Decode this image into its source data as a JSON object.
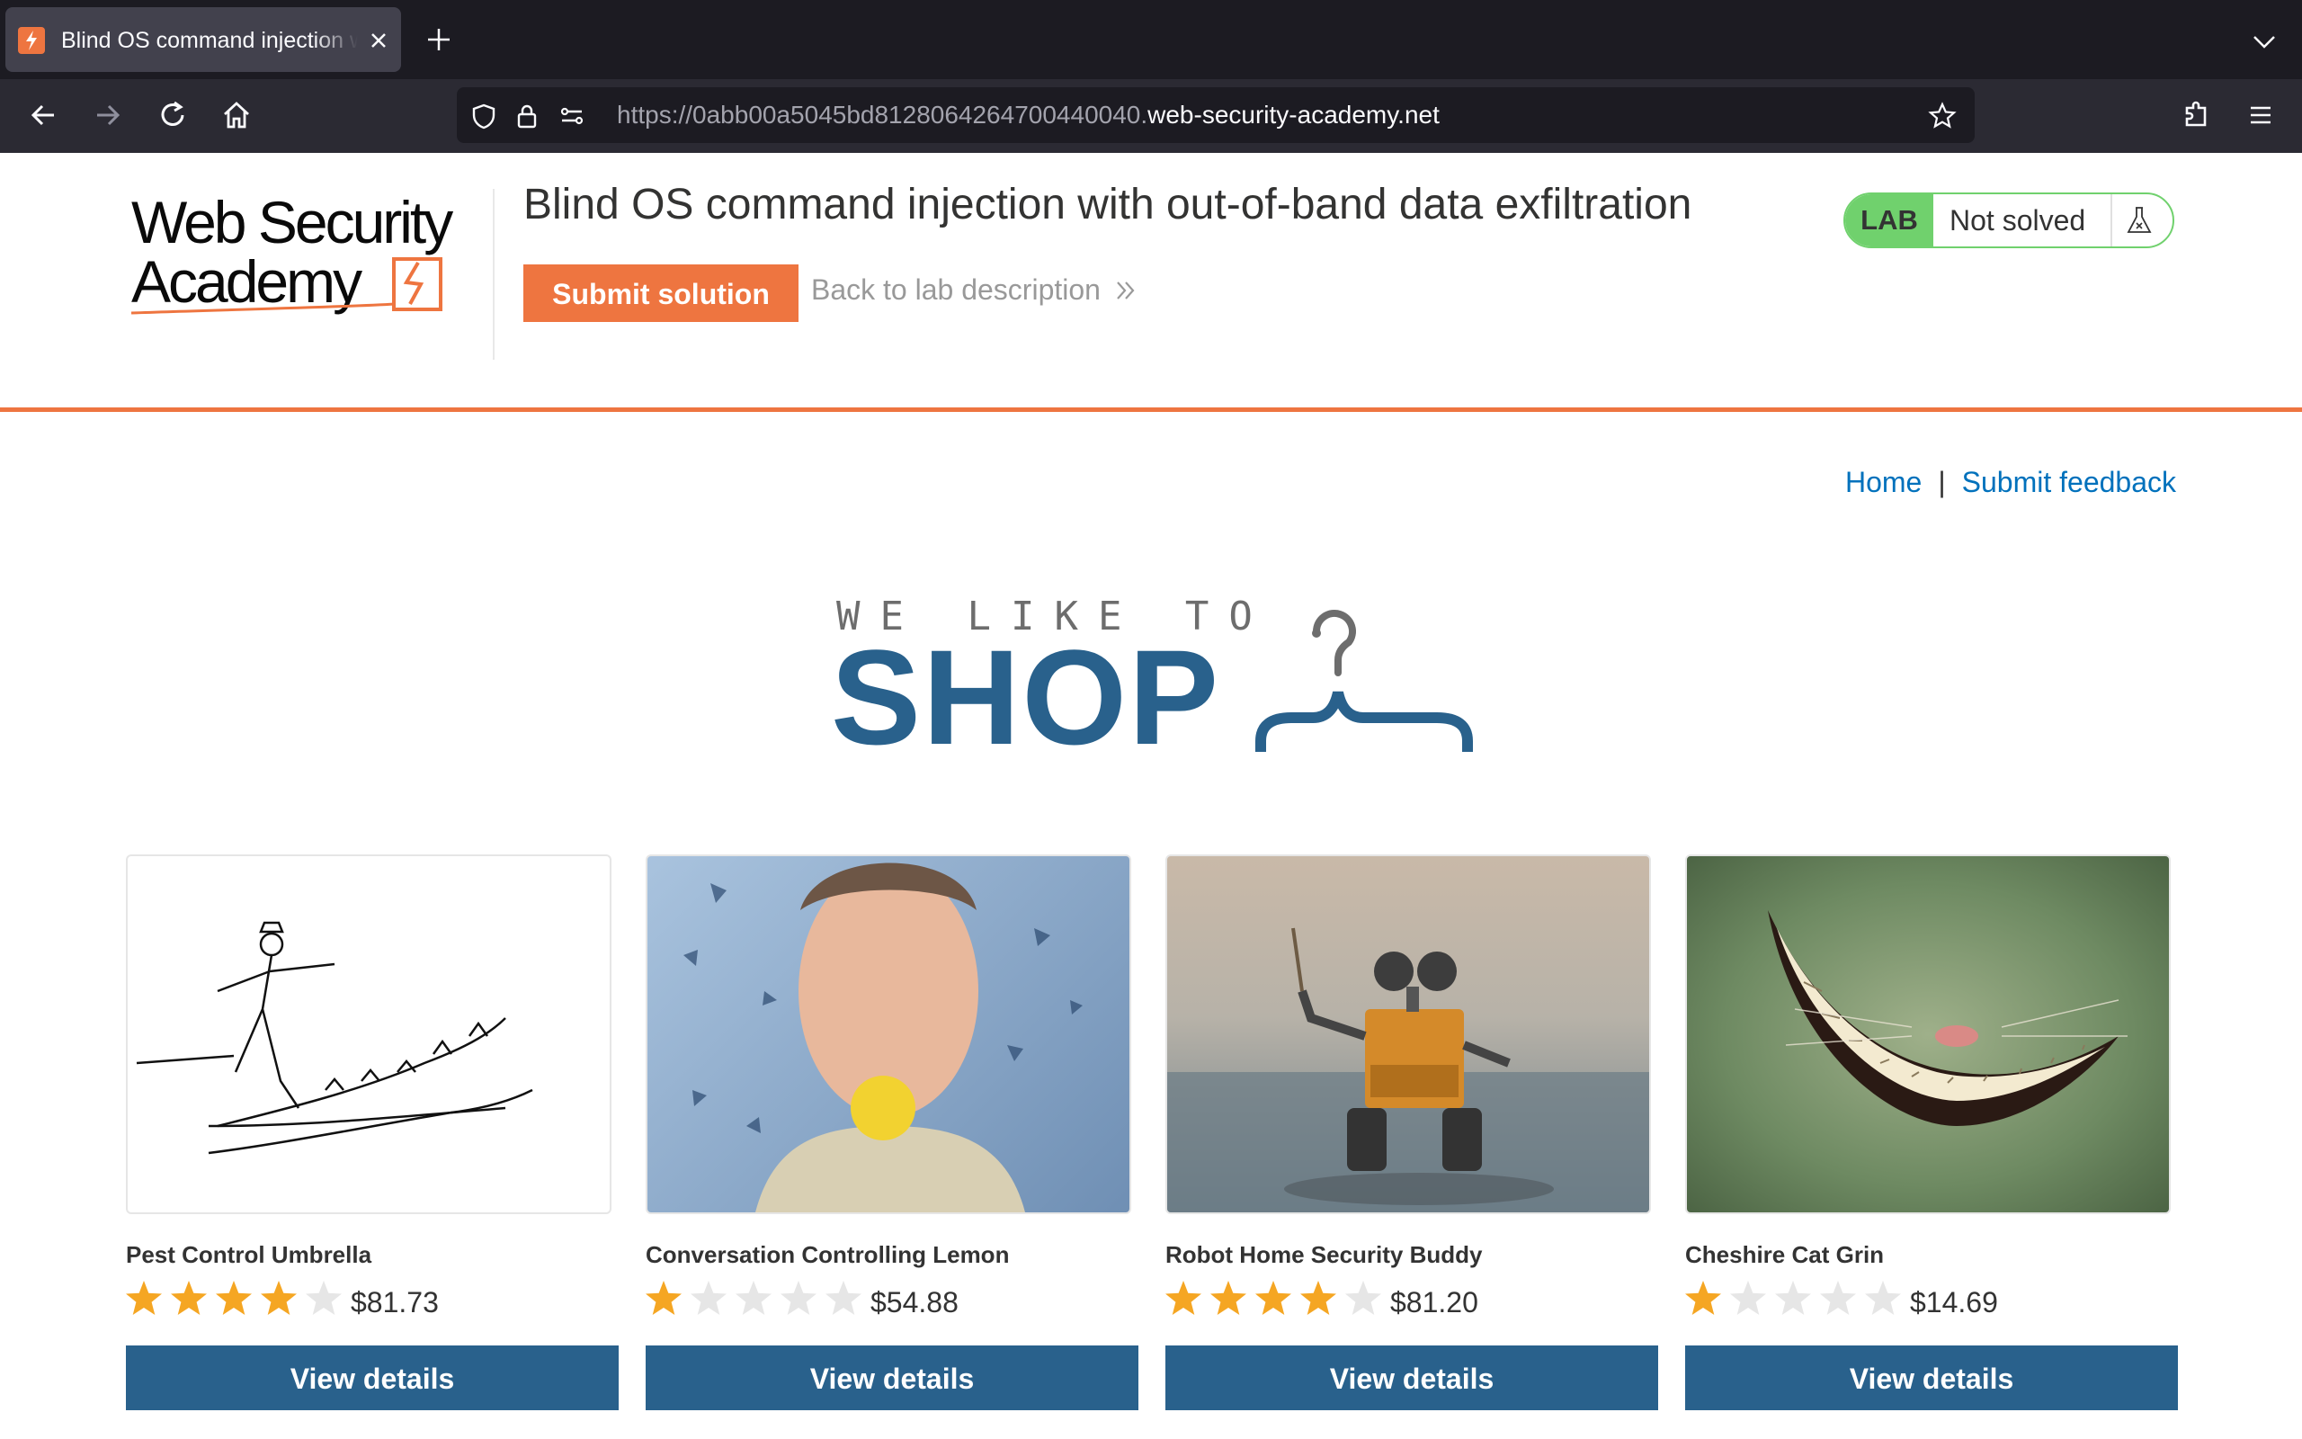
{
  "browser": {
    "tab_title": "Blind OS command injection with out-of-band data exfiltration",
    "url_prefix": "https://0abb00a5045bd8128064264700440040.",
    "url_domain": "web-security-academy.net"
  },
  "lab": {
    "logo_text_line1": "Web Security",
    "logo_text_line2": "Academy",
    "title": "Blind OS command injection with out-of-band data exfiltration",
    "submit_label": "Submit solution",
    "back_label": "Back to lab description",
    "status_badge": "LAB",
    "status_text": "Not solved",
    "accent_color": "#ee7540",
    "status_color": "#70d16d"
  },
  "nav": {
    "home": "Home",
    "separator": "|",
    "feedback": "Submit feedback"
  },
  "banner": {
    "line1": "WE LIKE TO",
    "line2": "SHOP"
  },
  "products": [
    {
      "name": "Pest Control Umbrella",
      "rating": 4,
      "price": "$81.73",
      "button": "View details"
    },
    {
      "name": "Conversation Controlling Lemon",
      "rating": 1,
      "price": "$54.88",
      "button": "View details"
    },
    {
      "name": "Robot Home Security Buddy",
      "rating": 4,
      "price": "$81.20",
      "button": "View details"
    },
    {
      "name": "Cheshire Cat Grin",
      "rating": 1,
      "price": "$14.69",
      "button": "View details"
    }
  ],
  "colors": {
    "primary_button": "#29618c",
    "link": "#0071bc"
  }
}
